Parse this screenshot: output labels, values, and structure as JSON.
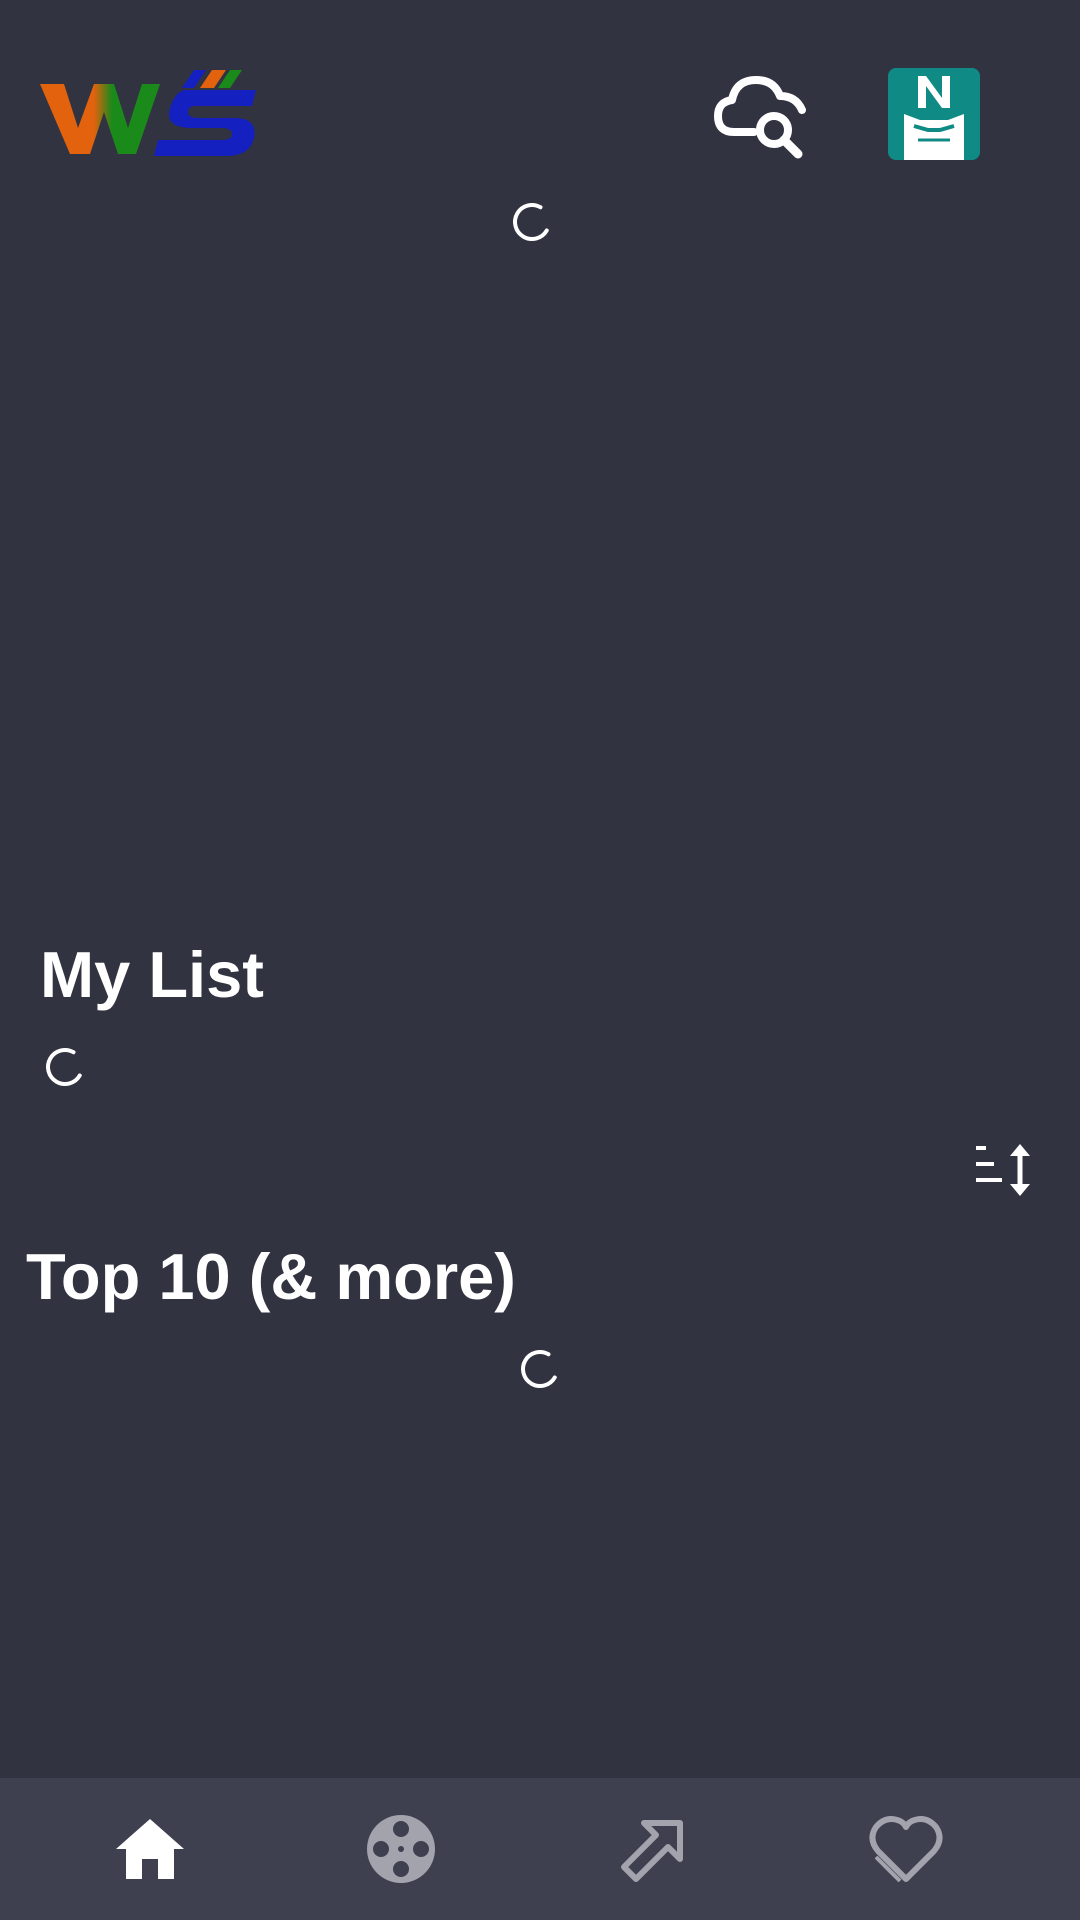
{
  "header": {
    "logo_icon": "ws-logo",
    "search_icon": "cloud-search-icon",
    "avatar_icon": "profile-avatar-n"
  },
  "sections": {
    "my_list_title": "My List",
    "top10_title": "Top 10 (& more)"
  },
  "bottom_nav": {
    "items": [
      {
        "icon": "home-icon",
        "active": true
      },
      {
        "icon": "film-reel-icon",
        "active": false
      },
      {
        "icon": "share-arrow-icon",
        "active": false
      },
      {
        "icon": "heart-icon",
        "active": false
      }
    ]
  },
  "colors": {
    "background": "#323340",
    "nav_background": "#3e3f4f",
    "avatar_teal": "#0f8a84",
    "logo_orange": "#e2620e",
    "logo_green": "#1a8a1a",
    "logo_blue": "#1420c0",
    "inactive_icon": "#a3a3ad"
  }
}
